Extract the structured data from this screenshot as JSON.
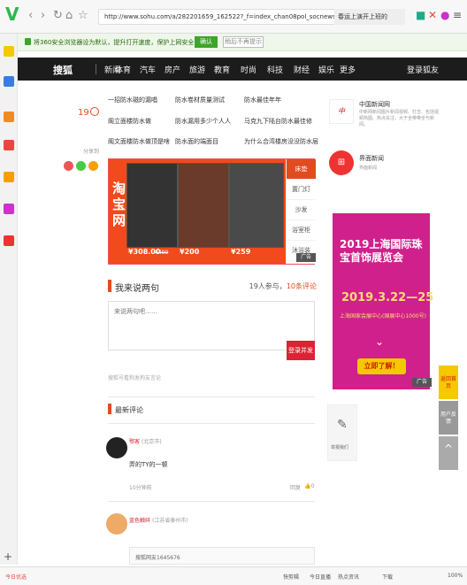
{
  "browser": {
    "url": "http://www.sohu.com/a/282201659_162522?_f=index_chan08pol_socnews",
    "search": "春运上演开上班的"
  },
  "security_bar": {
    "text": "将360安全浏览器设为默认，提升打开速度，保护上网安全",
    "confirm": "确认",
    "later": "稍后不再提示"
  },
  "nav": {
    "logo": "搜狐",
    "items": [
      "新闻",
      "体育",
      "汽车",
      "房产",
      "旅游",
      "教育",
      "时尚",
      "科技",
      "财经",
      "娱乐",
      "更多"
    ],
    "login": "登录狐友"
  },
  "left_meta": {
    "comments": "19",
    "share": "分享到"
  },
  "related_links": [
    [
      "一招防水磁的漏唱",
      "防水卷材质量测试",
      "防水最佳年年"
    ],
    [
      "阁立面楼防水做",
      "防水漏用多少个人人",
      "马克九下陆台防水最佳修"
    ],
    [
      "阁文面楼防水做顶是啥",
      "防水面的端面目",
      "为什么合湾楼房没没防水层"
    ]
  ],
  "ad": {
    "brand": "淘宝网",
    "prices": [
      "¥308.00",
      "¥200",
      "¥259"
    ],
    "old_price": "¥499",
    "menu": [
      "床垫",
      "置门灯",
      "沙发",
      "浴室柜",
      "沐浴装"
    ],
    "badge": "广告"
  },
  "comments": {
    "title": "我来说两句",
    "participants": "19人参与，",
    "count": "10条评论",
    "placeholder": "来说两句吧……",
    "post": "登录并发表",
    "hint": "搜狐号看狗发狗友言论",
    "latest": "最新评论",
    "items": [
      {
        "user": "鄂客",
        "location": "(北京市)",
        "text": "弄的TY的一顿",
        "time": "10分钟前",
        "reply": "回复",
        "likes": "0"
      },
      {
        "user": "蓝色触碎",
        "location": "(江苏省泰州市)",
        "text": "",
        "time": "",
        "reply": "",
        "likes": ""
      }
    ],
    "reply_box": "搜狐网友1645676"
  },
  "right": {
    "media1": {
      "name": "中国新闻网",
      "desc": "中新网新闻图片新闻视频、打击、包括视频热图、热点关注，大于全带带全与新闻。"
    },
    "media2": {
      "name": "界面新闻",
      "desc": "界面新闻"
    },
    "expo": {
      "title": "2019上海国际珠宝首饰展览会",
      "dates": "2019.3.22—25",
      "place": "上海国家会展中心(国展中心1000号)",
      "button": "立即了解！",
      "badge": "广告"
    },
    "feedback": "举报我们"
  },
  "tools": [
    "返回首页",
    "用户反馈"
  ],
  "status": {
    "left": "今日优选",
    "items": [
      "快剪辑",
      "今日直播",
      "热点资讯",
      "下载",
      "100%"
    ]
  },
  "colors": {
    "accent": "#e24b1f",
    "nav": "#1c1c1c",
    "expo": "#d0208b"
  }
}
